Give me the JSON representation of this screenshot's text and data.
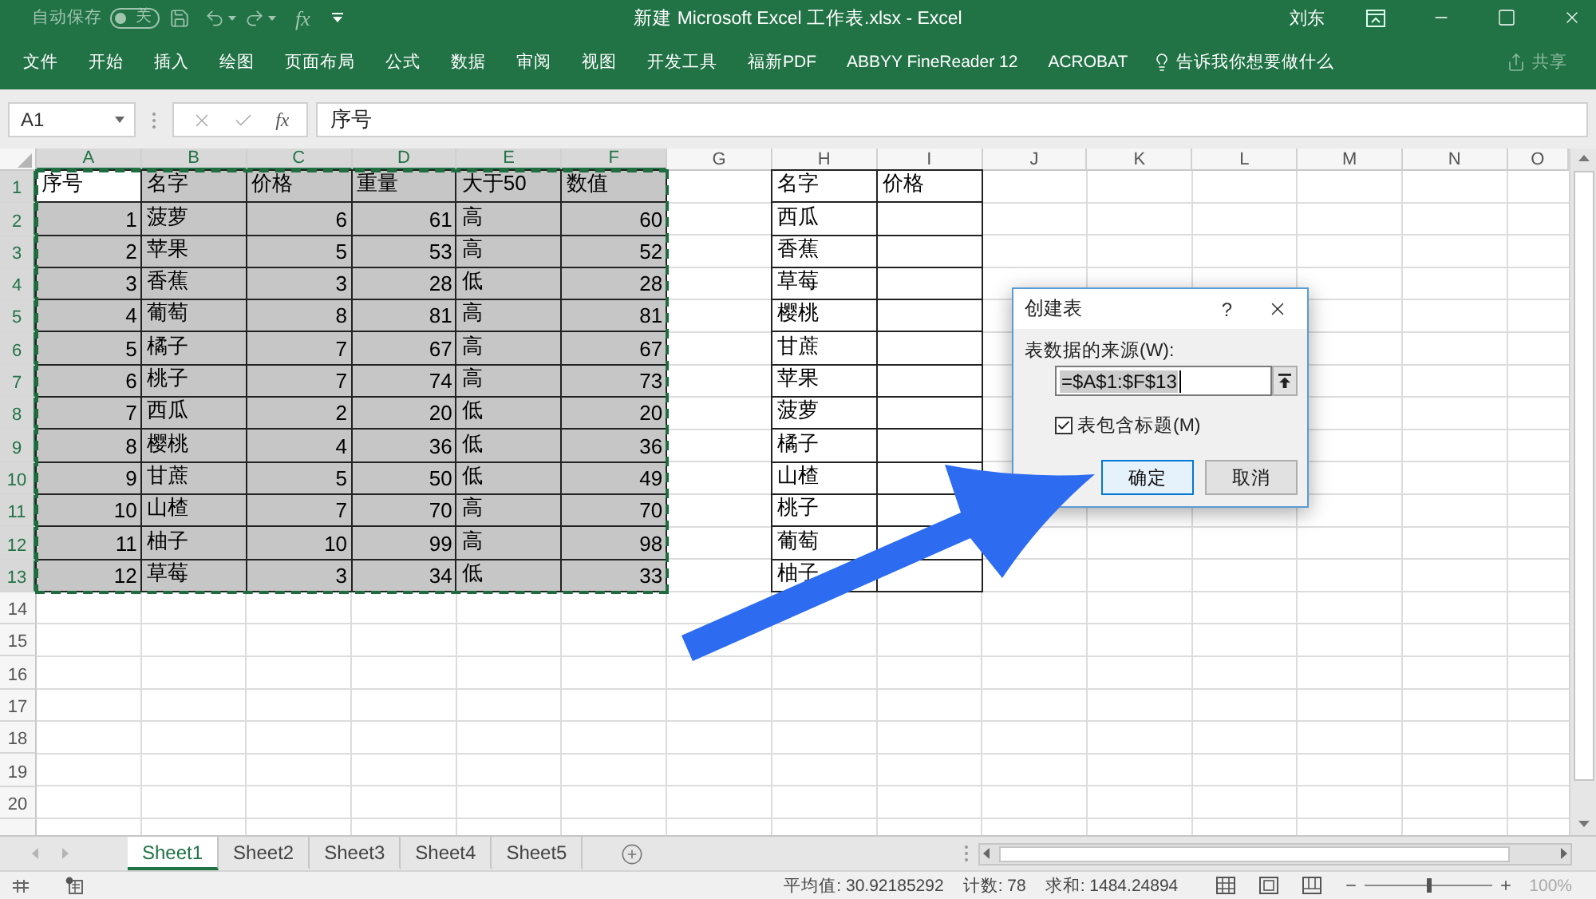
{
  "title_bar": {
    "autosave": {
      "label": "自动保存",
      "switch_text": "关",
      "on": false
    },
    "quick_access": {
      "disabled": true,
      "fx_label": "fx"
    },
    "title": "新建 Microsoft Excel 工作表.xlsx - Excel",
    "user": "刘东"
  },
  "ribbon": {
    "tabs": [
      {
        "label": "文件",
        "selected": false
      },
      {
        "label": "开始",
        "selected": false
      },
      {
        "label": "插入",
        "selected": false
      },
      {
        "label": "绘图",
        "selected": false
      },
      {
        "label": "页面布局",
        "selected": false
      },
      {
        "label": "公式",
        "selected": false
      },
      {
        "label": "数据",
        "selected": false
      },
      {
        "label": "审阅",
        "selected": false
      },
      {
        "label": "视图",
        "selected": false
      },
      {
        "label": "开发工具",
        "selected": false
      },
      {
        "label": "福新PDF",
        "selected": false
      },
      {
        "label": "ABBYY FineReader 12",
        "selected": false
      },
      {
        "label": "ACROBAT",
        "selected": false
      }
    ],
    "tell_me": "告诉我你想要做什么",
    "share": {
      "label": "共享",
      "disabled": true
    }
  },
  "formula_bar": {
    "name_box": "A1",
    "fx_label": "fx",
    "formula": "序号"
  },
  "sheet": {
    "columns": [
      {
        "label": "A",
        "selected": true
      },
      {
        "label": "B",
        "selected": true
      },
      {
        "label": "C",
        "selected": true
      },
      {
        "label": "D",
        "selected": true
      },
      {
        "label": "E",
        "selected": true
      },
      {
        "label": "F",
        "selected": true
      },
      {
        "label": "G",
        "selected": false
      },
      {
        "label": "H",
        "selected": false
      },
      {
        "label": "I",
        "selected": false
      },
      {
        "label": "J",
        "selected": false
      },
      {
        "label": "K",
        "selected": false
      },
      {
        "label": "L",
        "selected": false
      },
      {
        "label": "M",
        "selected": false
      },
      {
        "label": "N",
        "selected": false
      },
      {
        "label": "O",
        "selected": false
      }
    ],
    "rows": [
      {
        "label": "1",
        "selected": true
      },
      {
        "label": "2",
        "selected": true
      },
      {
        "label": "3",
        "selected": true
      },
      {
        "label": "4",
        "selected": true
      },
      {
        "label": "5",
        "selected": true
      },
      {
        "label": "6",
        "selected": true
      },
      {
        "label": "7",
        "selected": true
      },
      {
        "label": "8",
        "selected": true
      },
      {
        "label": "9",
        "selected": true
      },
      {
        "label": "10",
        "selected": true
      },
      {
        "label": "11",
        "selected": true
      },
      {
        "label": "12",
        "selected": true
      },
      {
        "label": "13",
        "selected": true
      },
      {
        "label": "14",
        "selected": false
      },
      {
        "label": "15",
        "selected": false
      },
      {
        "label": "16",
        "selected": false
      },
      {
        "label": "17",
        "selected": false
      },
      {
        "label": "18",
        "selected": false
      },
      {
        "label": "19",
        "selected": false
      },
      {
        "label": "20",
        "selected": false
      }
    ],
    "table_1": {
      "selected": true,
      "columns": [
        {
          "label": "序号",
          "kind": "number"
        },
        {
          "label": "名字",
          "kind": "text"
        },
        {
          "label": "价格",
          "kind": "number"
        },
        {
          "label": "重量",
          "kind": "number"
        },
        {
          "label": "大于50",
          "kind": "text"
        },
        {
          "label": "数值",
          "kind": "number"
        }
      ],
      "rows": [
        [
          "1",
          "菠萝",
          "6",
          "61",
          "高",
          "60"
        ],
        [
          "2",
          "苹果",
          "5",
          "53",
          "高",
          "52"
        ],
        [
          "3",
          "香蕉",
          "3",
          "28",
          "低",
          "28"
        ],
        [
          "4",
          "葡萄",
          "8",
          "81",
          "高",
          "81"
        ],
        [
          "5",
          "橘子",
          "7",
          "67",
          "高",
          "67"
        ],
        [
          "6",
          "桃子",
          "7",
          "74",
          "高",
          "73"
        ],
        [
          "7",
          "西瓜",
          "2",
          "20",
          "低",
          "20"
        ],
        [
          "8",
          "樱桃",
          "4",
          "36",
          "低",
          "36"
        ],
        [
          "9",
          "甘蔗",
          "5",
          "50",
          "低",
          "49"
        ],
        [
          "10",
          "山楂",
          "7",
          "70",
          "高",
          "70"
        ],
        [
          "11",
          "柚子",
          "10",
          "99",
          "高",
          "98"
        ],
        [
          "12",
          "草莓",
          "3",
          "34",
          "低",
          "33"
        ]
      ]
    },
    "table_2": {
      "selected": false,
      "columns": [
        "名字",
        "价格"
      ],
      "names": [
        "西瓜",
        "香蕉",
        "草莓",
        "樱桃",
        "甘蔗",
        "苹果",
        "菠萝",
        "橘子",
        "山楂",
        "桃子",
        "葡萄",
        "柚子"
      ]
    }
  },
  "sheet_tabs": [
    {
      "label": "Sheet1",
      "selected": true
    },
    {
      "label": "Sheet2",
      "selected": false
    },
    {
      "label": "Sheet3",
      "selected": false
    },
    {
      "label": "Sheet4",
      "selected": false
    },
    {
      "label": "Sheet5",
      "selected": false
    }
  ],
  "dialog": {
    "title": "创建表",
    "help": "?",
    "source_label": "表数据的来源(W):",
    "source_value": "=$A$1:$F$13",
    "has_headers": {
      "label": "表包含标题(M)",
      "checked": true
    },
    "buttons": [
      {
        "label": "确定",
        "focused": true
      },
      {
        "label": "取消",
        "focused": false
      }
    ]
  },
  "status_bar": {
    "average": "平均值: 30.92185292",
    "count": "计数: 78",
    "sum": "求和: 1484.24894",
    "zoom": {
      "level": 0.5,
      "label": "100%"
    }
  }
}
